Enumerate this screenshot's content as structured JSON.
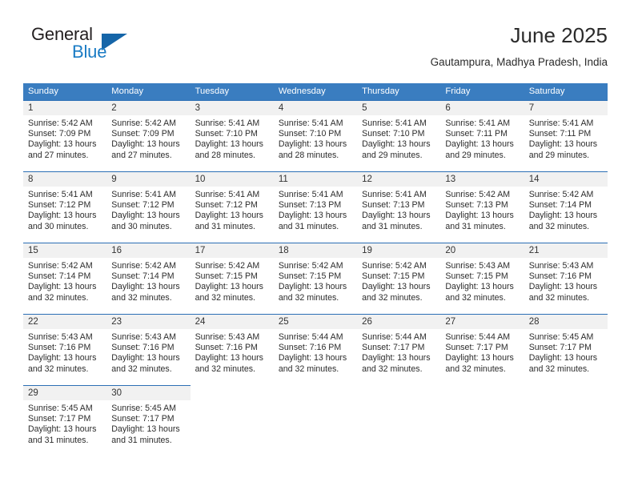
{
  "brand": {
    "name_part1": "General",
    "name_part2": "Blue",
    "logo_icon": "triangle-flag-icon",
    "accent_color": "#1565a8",
    "blue_text_color": "#1a7bc4"
  },
  "header": {
    "title": "June 2025",
    "location": "Gautampura, Madhya Pradesh, India"
  },
  "theme": {
    "header_row_bg": "#3a7dc0",
    "day_band_bg": "#f1f1f1",
    "week_border": "#2c6fb5",
    "text": "#2c2c2c"
  },
  "calendar": {
    "weekday_headers": [
      "Sunday",
      "Monday",
      "Tuesday",
      "Wednesday",
      "Thursday",
      "Friday",
      "Saturday"
    ],
    "weeks": [
      [
        {
          "day": "1",
          "sunrise": "Sunrise: 5:42 AM",
          "sunset": "Sunset: 7:09 PM",
          "daylight_line1": "Daylight: 13 hours",
          "daylight_line2": "and 27 minutes."
        },
        {
          "day": "2",
          "sunrise": "Sunrise: 5:42 AM",
          "sunset": "Sunset: 7:09 PM",
          "daylight_line1": "Daylight: 13 hours",
          "daylight_line2": "and 27 minutes."
        },
        {
          "day": "3",
          "sunrise": "Sunrise: 5:41 AM",
          "sunset": "Sunset: 7:10 PM",
          "daylight_line1": "Daylight: 13 hours",
          "daylight_line2": "and 28 minutes."
        },
        {
          "day": "4",
          "sunrise": "Sunrise: 5:41 AM",
          "sunset": "Sunset: 7:10 PM",
          "daylight_line1": "Daylight: 13 hours",
          "daylight_line2": "and 28 minutes."
        },
        {
          "day": "5",
          "sunrise": "Sunrise: 5:41 AM",
          "sunset": "Sunset: 7:10 PM",
          "daylight_line1": "Daylight: 13 hours",
          "daylight_line2": "and 29 minutes."
        },
        {
          "day": "6",
          "sunrise": "Sunrise: 5:41 AM",
          "sunset": "Sunset: 7:11 PM",
          "daylight_line1": "Daylight: 13 hours",
          "daylight_line2": "and 29 minutes."
        },
        {
          "day": "7",
          "sunrise": "Sunrise: 5:41 AM",
          "sunset": "Sunset: 7:11 PM",
          "daylight_line1": "Daylight: 13 hours",
          "daylight_line2": "and 29 minutes."
        }
      ],
      [
        {
          "day": "8",
          "sunrise": "Sunrise: 5:41 AM",
          "sunset": "Sunset: 7:12 PM",
          "daylight_line1": "Daylight: 13 hours",
          "daylight_line2": "and 30 minutes."
        },
        {
          "day": "9",
          "sunrise": "Sunrise: 5:41 AM",
          "sunset": "Sunset: 7:12 PM",
          "daylight_line1": "Daylight: 13 hours",
          "daylight_line2": "and 30 minutes."
        },
        {
          "day": "10",
          "sunrise": "Sunrise: 5:41 AM",
          "sunset": "Sunset: 7:12 PM",
          "daylight_line1": "Daylight: 13 hours",
          "daylight_line2": "and 31 minutes."
        },
        {
          "day": "11",
          "sunrise": "Sunrise: 5:41 AM",
          "sunset": "Sunset: 7:13 PM",
          "daylight_line1": "Daylight: 13 hours",
          "daylight_line2": "and 31 minutes."
        },
        {
          "day": "12",
          "sunrise": "Sunrise: 5:41 AM",
          "sunset": "Sunset: 7:13 PM",
          "daylight_line1": "Daylight: 13 hours",
          "daylight_line2": "and 31 minutes."
        },
        {
          "day": "13",
          "sunrise": "Sunrise: 5:42 AM",
          "sunset": "Sunset: 7:13 PM",
          "daylight_line1": "Daylight: 13 hours",
          "daylight_line2": "and 31 minutes."
        },
        {
          "day": "14",
          "sunrise": "Sunrise: 5:42 AM",
          "sunset": "Sunset: 7:14 PM",
          "daylight_line1": "Daylight: 13 hours",
          "daylight_line2": "and 32 minutes."
        }
      ],
      [
        {
          "day": "15",
          "sunrise": "Sunrise: 5:42 AM",
          "sunset": "Sunset: 7:14 PM",
          "daylight_line1": "Daylight: 13 hours",
          "daylight_line2": "and 32 minutes."
        },
        {
          "day": "16",
          "sunrise": "Sunrise: 5:42 AM",
          "sunset": "Sunset: 7:14 PM",
          "daylight_line1": "Daylight: 13 hours",
          "daylight_line2": "and 32 minutes."
        },
        {
          "day": "17",
          "sunrise": "Sunrise: 5:42 AM",
          "sunset": "Sunset: 7:15 PM",
          "daylight_line1": "Daylight: 13 hours",
          "daylight_line2": "and 32 minutes."
        },
        {
          "day": "18",
          "sunrise": "Sunrise: 5:42 AM",
          "sunset": "Sunset: 7:15 PM",
          "daylight_line1": "Daylight: 13 hours",
          "daylight_line2": "and 32 minutes."
        },
        {
          "day": "19",
          "sunrise": "Sunrise: 5:42 AM",
          "sunset": "Sunset: 7:15 PM",
          "daylight_line1": "Daylight: 13 hours",
          "daylight_line2": "and 32 minutes."
        },
        {
          "day": "20",
          "sunrise": "Sunrise: 5:43 AM",
          "sunset": "Sunset: 7:15 PM",
          "daylight_line1": "Daylight: 13 hours",
          "daylight_line2": "and 32 minutes."
        },
        {
          "day": "21",
          "sunrise": "Sunrise: 5:43 AM",
          "sunset": "Sunset: 7:16 PM",
          "daylight_line1": "Daylight: 13 hours",
          "daylight_line2": "and 32 minutes."
        }
      ],
      [
        {
          "day": "22",
          "sunrise": "Sunrise: 5:43 AM",
          "sunset": "Sunset: 7:16 PM",
          "daylight_line1": "Daylight: 13 hours",
          "daylight_line2": "and 32 minutes."
        },
        {
          "day": "23",
          "sunrise": "Sunrise: 5:43 AM",
          "sunset": "Sunset: 7:16 PM",
          "daylight_line1": "Daylight: 13 hours",
          "daylight_line2": "and 32 minutes."
        },
        {
          "day": "24",
          "sunrise": "Sunrise: 5:43 AM",
          "sunset": "Sunset: 7:16 PM",
          "daylight_line1": "Daylight: 13 hours",
          "daylight_line2": "and 32 minutes."
        },
        {
          "day": "25",
          "sunrise": "Sunrise: 5:44 AM",
          "sunset": "Sunset: 7:16 PM",
          "daylight_line1": "Daylight: 13 hours",
          "daylight_line2": "and 32 minutes."
        },
        {
          "day": "26",
          "sunrise": "Sunrise: 5:44 AM",
          "sunset": "Sunset: 7:17 PM",
          "daylight_line1": "Daylight: 13 hours",
          "daylight_line2": "and 32 minutes."
        },
        {
          "day": "27",
          "sunrise": "Sunrise: 5:44 AM",
          "sunset": "Sunset: 7:17 PM",
          "daylight_line1": "Daylight: 13 hours",
          "daylight_line2": "and 32 minutes."
        },
        {
          "day": "28",
          "sunrise": "Sunrise: 5:45 AM",
          "sunset": "Sunset: 7:17 PM",
          "daylight_line1": "Daylight: 13 hours",
          "daylight_line2": "and 32 minutes."
        }
      ],
      [
        {
          "day": "29",
          "sunrise": "Sunrise: 5:45 AM",
          "sunset": "Sunset: 7:17 PM",
          "daylight_line1": "Daylight: 13 hours",
          "daylight_line2": "and 31 minutes."
        },
        {
          "day": "30",
          "sunrise": "Sunrise: 5:45 AM",
          "sunset": "Sunset: 7:17 PM",
          "daylight_line1": "Daylight: 13 hours",
          "daylight_line2": "and 31 minutes."
        },
        {
          "day": "",
          "sunrise": "",
          "sunset": "",
          "daylight_line1": "",
          "daylight_line2": ""
        },
        {
          "day": "",
          "sunrise": "",
          "sunset": "",
          "daylight_line1": "",
          "daylight_line2": ""
        },
        {
          "day": "",
          "sunrise": "",
          "sunset": "",
          "daylight_line1": "",
          "daylight_line2": ""
        },
        {
          "day": "",
          "sunrise": "",
          "sunset": "",
          "daylight_line1": "",
          "daylight_line2": ""
        },
        {
          "day": "",
          "sunrise": "",
          "sunset": "",
          "daylight_line1": "",
          "daylight_line2": ""
        }
      ]
    ]
  }
}
